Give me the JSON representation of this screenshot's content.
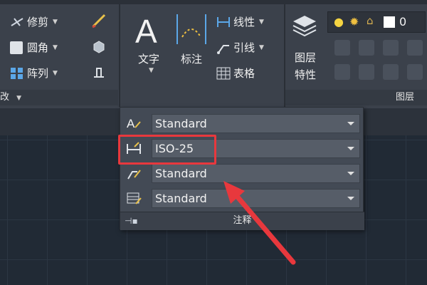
{
  "ribbon": {
    "modify_panel": {
      "trim_label": "修剪",
      "fillet_label": "圆角",
      "array_label": "阵列",
      "title_fragment": "改"
    },
    "annotation_panel": {
      "text_label": "文字",
      "dimension_label": "标注",
      "linear_label": "线性",
      "leader_label": "引线",
      "table_label": "表格"
    },
    "layers_panel": {
      "layer_properties_label_line1": "图层",
      "layer_properties_label_line2": "特性",
      "title": "图层",
      "layer_current": "0"
    }
  },
  "annotation_dropdown": {
    "rows": [
      {
        "icon": "text-style-icon",
        "value": "Standard"
      },
      {
        "icon": "dimension-style-icon",
        "value": "ISO-25"
      },
      {
        "icon": "multileader-style-icon",
        "value": "Standard"
      },
      {
        "icon": "table-style-icon",
        "value": "Standard"
      }
    ],
    "footer_label": "注释"
  },
  "colors": {
    "highlight": "#e8383d",
    "ribbon_bg": "#3b414b",
    "canvas_bg": "#212a35"
  }
}
